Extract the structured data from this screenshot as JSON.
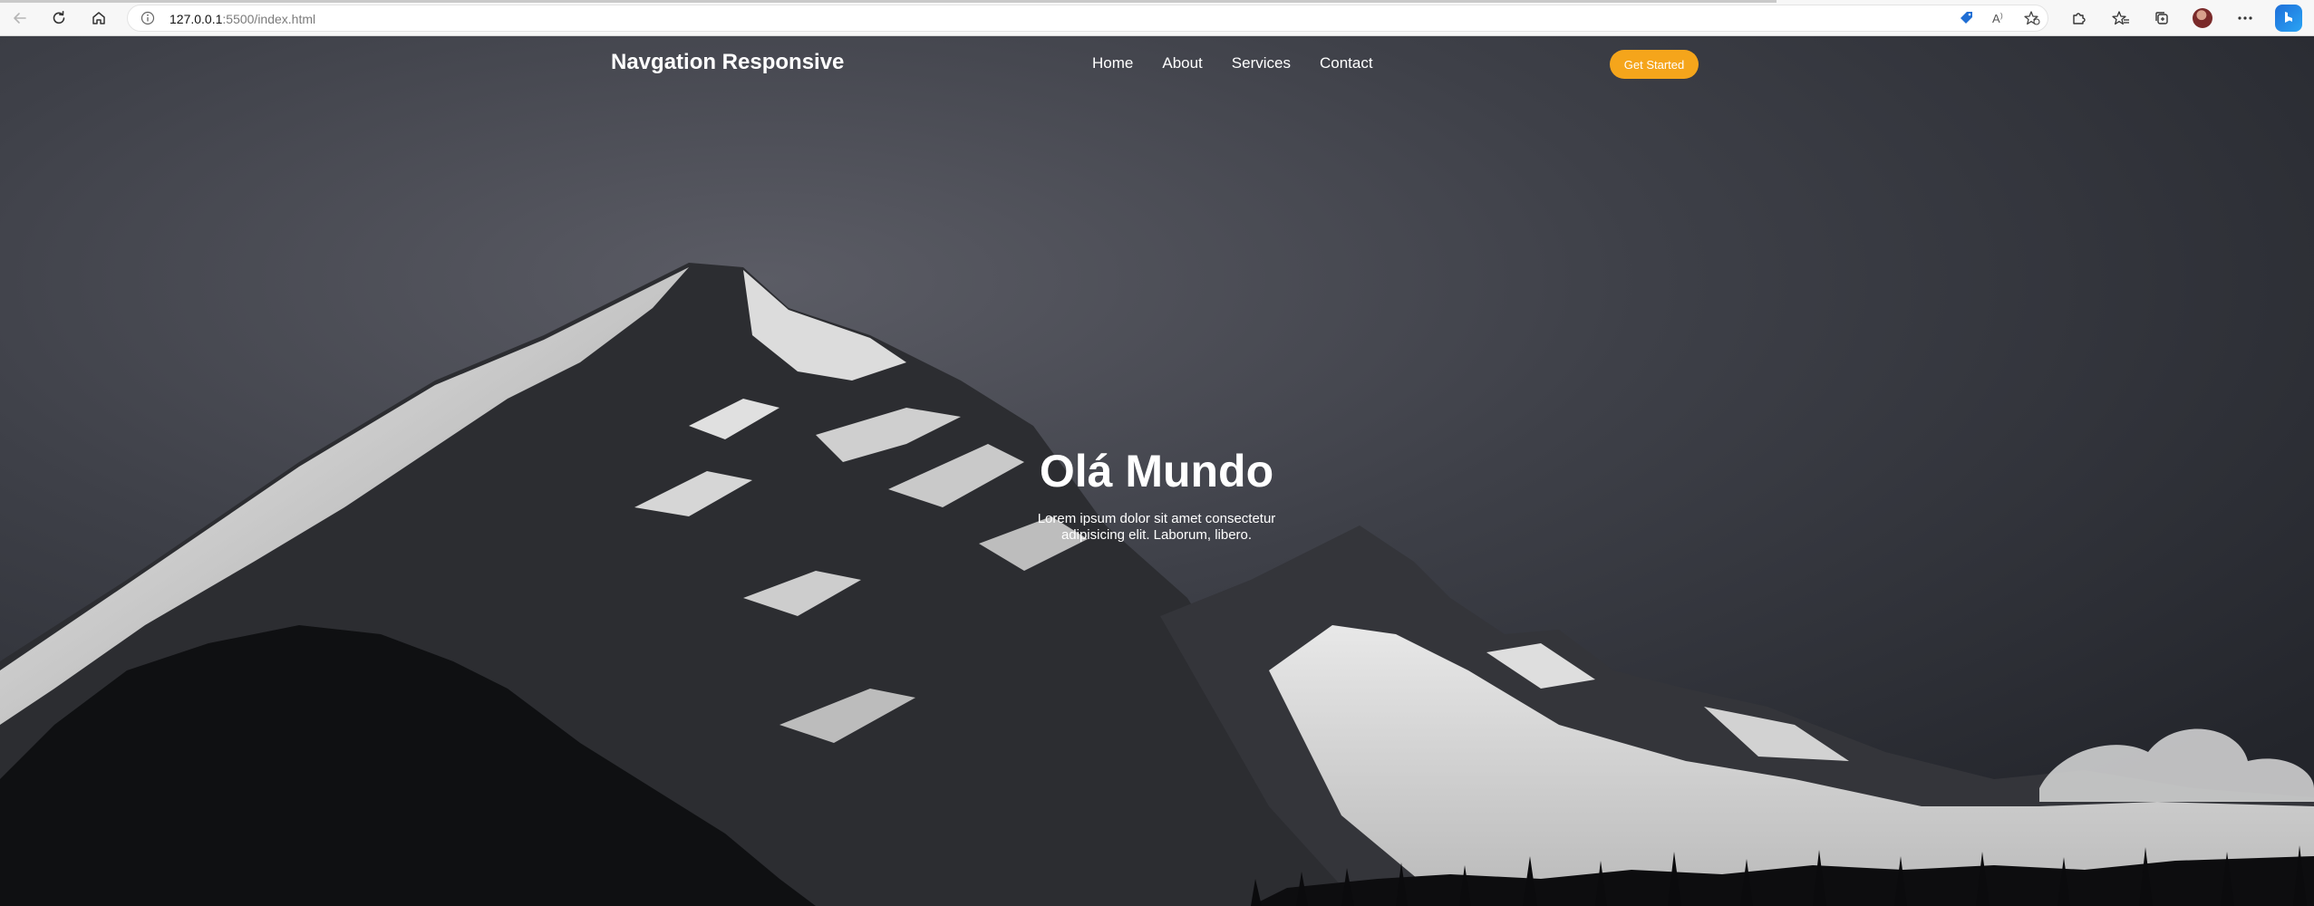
{
  "browser": {
    "url_host": "127.0.0.1",
    "url_path": ":5500/index.html",
    "icons": [
      "back-icon",
      "reload-icon",
      "home-icon",
      "site-info-icon",
      "tag-icon",
      "read-aloud-icon",
      "favorite-add-icon",
      "extensions-icon",
      "favorites-icon",
      "collections-icon",
      "profile-avatar",
      "more-icon",
      "copilot-icon"
    ]
  },
  "site": {
    "logo": "Navgation Responsive",
    "nav": [
      {
        "label": "Home"
      },
      {
        "label": "About"
      },
      {
        "label": "Services"
      },
      {
        "label": "Contact"
      }
    ],
    "cta_label": "Get Started",
    "cta_color": "#f5a51b"
  },
  "hero": {
    "title": "Olá Mundo",
    "text": "Lorem ipsum dolor sit amet consectetur adipisicing elit. Laborum, libero."
  }
}
